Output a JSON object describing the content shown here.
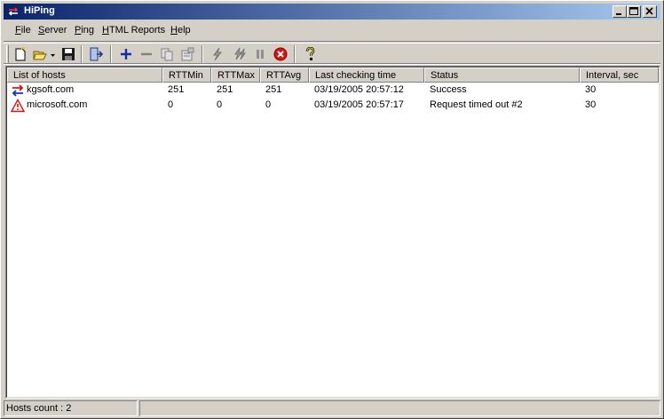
{
  "window": {
    "title": "HiPing"
  },
  "menu": [
    "File",
    "Server",
    "Ping",
    "HTML Reports",
    "Help"
  ],
  "menu_underline": [
    "F",
    "S",
    "P",
    "H",
    "H"
  ],
  "toolbar": {
    "buttons": [
      "new-icon",
      "open-icon",
      "dropdown-arrow-icon",
      "save-icon",
      "exit-icon",
      "add-icon",
      "remove-icon",
      "copy-icon",
      "properties-icon",
      "ping-icon",
      "ping-all-icon",
      "pause-icon",
      "stop-icon",
      "help-icon"
    ]
  },
  "list": {
    "columns": [
      "List of hosts",
      "RTTMin",
      "RTTMax",
      "RTTAvg",
      "Last checking time",
      "Status",
      "Interval, sec"
    ],
    "rows": [
      {
        "icon": "success-arrows-icon",
        "host": "kgsoft.com",
        "rttmin": "251",
        "rttmax": "251",
        "rttavg": "251",
        "time": "03/19/2005 20:57:12",
        "status": "Success",
        "interval": "30"
      },
      {
        "icon": "warning-icon",
        "host": "microsoft.com",
        "rttmin": "0",
        "rttmax": "0",
        "rttavg": "0",
        "time": "03/19/2005 20:57:17",
        "status": "Request timed out #2",
        "interval": "30"
      }
    ]
  },
  "status": {
    "hosts_count": "Hosts count : 2",
    "panel2": ""
  },
  "colors": {
    "title_start": "#0a246a",
    "title_end": "#a6caf0",
    "face": "#d4d0c8"
  }
}
